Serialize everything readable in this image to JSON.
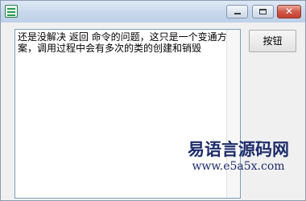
{
  "window": {
    "title_bar": {
      "minimize_glyph": "–",
      "maximize_glyph": "□",
      "close_glyph": "✕"
    }
  },
  "editor": {
    "text": "还是没解决 返回 命令的问题，这只是一个变通方案，调用过程中会有多次的类的创建和销毁"
  },
  "action_button": {
    "label": "按钮"
  },
  "watermark": {
    "title": "易语言源码网",
    "url": "www.e5a5x.com"
  },
  "colors": {
    "title_bar": "#c9d9ec",
    "close_button": "#c3412f",
    "watermark": "#1d2c6b"
  }
}
